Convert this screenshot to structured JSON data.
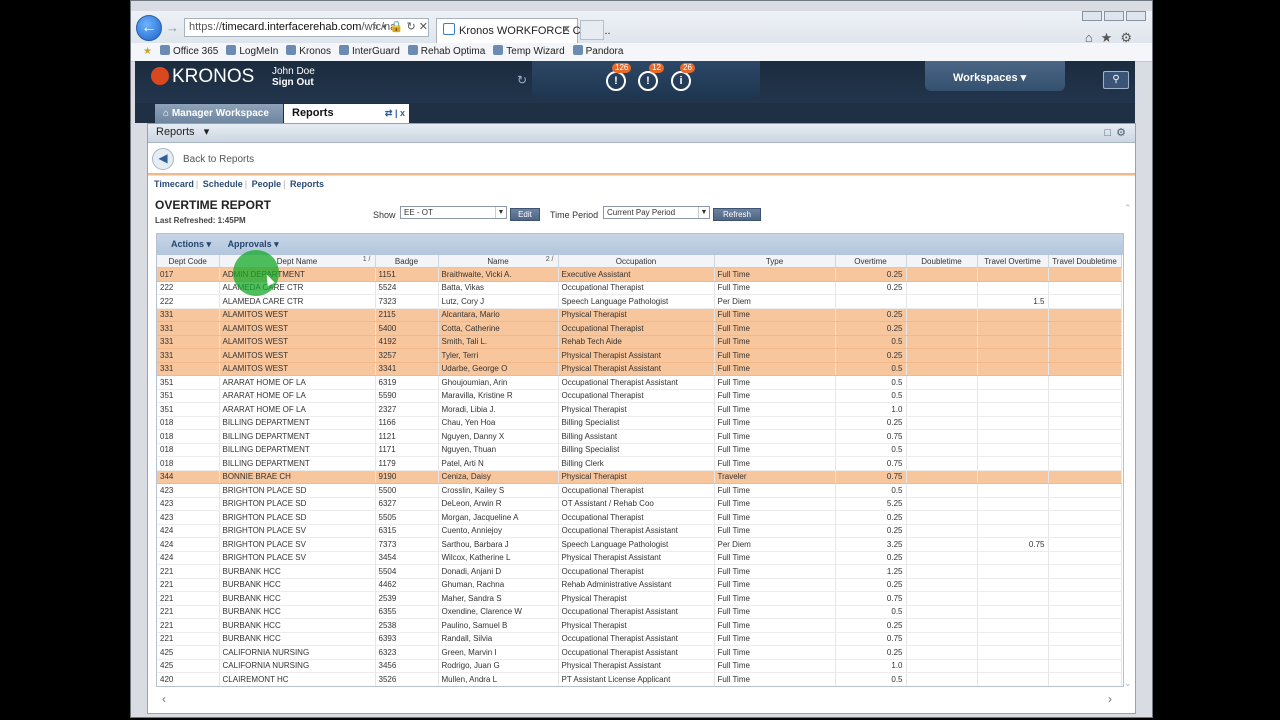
{
  "browser": {
    "url_prefix": "https://",
    "url_domain": "timecard.interfacerehab.com",
    "url_rest": "/wfc/na",
    "tab_title": "Kronos WORKFORCE CENT...",
    "favorites": [
      "Office 365",
      "LogMeIn",
      "Kronos",
      "InterGuard",
      "Rehab Optima",
      "Temp Wizard",
      "Pandora"
    ]
  },
  "header": {
    "logo": "KRONOS",
    "user_name": "John Doe",
    "sign_out": "Sign Out",
    "alerts": [
      {
        "icon": "info-alert-icon",
        "count": "126",
        "glyph": "!"
      },
      {
        "icon": "timecard-alert-icon",
        "count": "12",
        "glyph": "!"
      },
      {
        "icon": "people-alert-icon",
        "count": "26",
        "glyph": "i"
      }
    ],
    "workspaces_label": "Workspaces"
  },
  "tabs": {
    "manager": "Manager Workspace",
    "reports": "Reports"
  },
  "panel": {
    "title": "Reports",
    "back_label": "Back to Reports",
    "nav_links": [
      "Timecard",
      "Schedule",
      "People",
      "Reports"
    ]
  },
  "report": {
    "title": "OVERTIME REPORT",
    "last_refreshed": "Last Refreshed: 1:45PM",
    "show_label": "Show",
    "show_value": "EE - OT",
    "edit_label": "Edit",
    "time_period_label": "Time Period",
    "time_period_value": "Current Pay Period",
    "refresh_label": "Refresh",
    "actions_label": "Actions",
    "approvals_label": "Approvals"
  },
  "columns": [
    "Dept Code",
    "Dept Name",
    "Badge",
    "Name",
    "Occupation",
    "Type",
    "Overtime",
    "Doubletime",
    "Travel Overtime",
    "Travel Doubletime"
  ],
  "sort_marks": {
    "dept_name": "1 /",
    "name": "2 /"
  },
  "rows": [
    {
      "code": "017",
      "dept": "ADMIN DEPARTMENT",
      "badge": "1151",
      "name": "Braithwaite, Vicki A.",
      "occ": "Executive Assistant",
      "type": "Full Time",
      "ot": "0.25",
      "dt": "",
      "tot": "",
      "tdt": "",
      "hl": true
    },
    {
      "code": "222",
      "dept": "ALAMEDA CARE CTR",
      "badge": "5524",
      "name": "Batta, Vikas",
      "occ": "Occupational Therapist",
      "type": "Full Time",
      "ot": "0.25",
      "dt": "",
      "tot": "",
      "tdt": "",
      "hl": false
    },
    {
      "code": "222",
      "dept": "ALAMEDA CARE CTR",
      "badge": "7323",
      "name": "Lutz, Cory J",
      "occ": "Speech Language Pathologist",
      "type": "Per Diem",
      "ot": "",
      "dt": "",
      "tot": "1.5",
      "tdt": "",
      "hl": false
    },
    {
      "code": "331",
      "dept": "ALAMITOS WEST",
      "badge": "2115",
      "name": "Alcantara, Mario",
      "occ": "Physical Therapist",
      "type": "Full Time",
      "ot": "0.25",
      "dt": "",
      "tot": "",
      "tdt": "",
      "hl": true
    },
    {
      "code": "331",
      "dept": "ALAMITOS WEST",
      "badge": "5400",
      "name": "Cotta, Catherine",
      "occ": "Occupational Therapist",
      "type": "Full Time",
      "ot": "0.25",
      "dt": "",
      "tot": "",
      "tdt": "",
      "hl": true
    },
    {
      "code": "331",
      "dept": "ALAMITOS WEST",
      "badge": "4192",
      "name": "Smith, Tali L.",
      "occ": "Rehab Tech Aide",
      "type": "Full Time",
      "ot": "0.5",
      "dt": "",
      "tot": "",
      "tdt": "",
      "hl": true
    },
    {
      "code": "331",
      "dept": "ALAMITOS WEST",
      "badge": "3257",
      "name": "Tyler, Terri",
      "occ": "Physical Therapist Assistant",
      "type": "Full Time",
      "ot": "0.25",
      "dt": "",
      "tot": "",
      "tdt": "",
      "hl": true
    },
    {
      "code": "331",
      "dept": "ALAMITOS WEST",
      "badge": "3341",
      "name": "Udarbe, George O",
      "occ": "Physical Therapist Assistant",
      "type": "Full Time",
      "ot": "0.5",
      "dt": "",
      "tot": "",
      "tdt": "",
      "hl": true
    },
    {
      "code": "351",
      "dept": "ARARAT HOME OF LA",
      "badge": "6319",
      "name": "Ghoujoumian, Arin",
      "occ": "Occupational Therapist Assistant",
      "type": "Full Time",
      "ot": "0.5",
      "dt": "",
      "tot": "",
      "tdt": "",
      "hl": false
    },
    {
      "code": "351",
      "dept": "ARARAT HOME OF LA",
      "badge": "5590",
      "name": "Maravilla, Kristine R",
      "occ": "Occupational Therapist",
      "type": "Full Time",
      "ot": "0.5",
      "dt": "",
      "tot": "",
      "tdt": "",
      "hl": false
    },
    {
      "code": "351",
      "dept": "ARARAT HOME OF LA",
      "badge": "2327",
      "name": "Moradi, Libia J.",
      "occ": "Physical Therapist",
      "type": "Full Time",
      "ot": "1.0",
      "dt": "",
      "tot": "",
      "tdt": "",
      "hl": false
    },
    {
      "code": "018",
      "dept": "BILLING DEPARTMENT",
      "badge": "1166",
      "name": "Chau, Yen Hoa",
      "occ": "Billing Specialist",
      "type": "Full Time",
      "ot": "0.25",
      "dt": "",
      "tot": "",
      "tdt": "",
      "hl": false
    },
    {
      "code": "018",
      "dept": "BILLING DEPARTMENT",
      "badge": "1121",
      "name": "Nguyen, Danny X",
      "occ": "Billing Assistant",
      "type": "Full Time",
      "ot": "0.75",
      "dt": "",
      "tot": "",
      "tdt": "",
      "hl": false
    },
    {
      "code": "018",
      "dept": "BILLING DEPARTMENT",
      "badge": "1171",
      "name": "Nguyen, Thuan",
      "occ": "Billing Specialist",
      "type": "Full Time",
      "ot": "0.5",
      "dt": "",
      "tot": "",
      "tdt": "",
      "hl": false
    },
    {
      "code": "018",
      "dept": "BILLING DEPARTMENT",
      "badge": "1179",
      "name": "Patel, Arti N",
      "occ": "Billing Clerk",
      "type": "Full Time",
      "ot": "0.75",
      "dt": "",
      "tot": "",
      "tdt": "",
      "hl": false
    },
    {
      "code": "344",
      "dept": "BONNIE BRAE CH",
      "badge": "9190",
      "name": "Ceniza, Daisy",
      "occ": "Physical Therapist",
      "type": "Traveler",
      "ot": "0.75",
      "dt": "",
      "tot": "",
      "tdt": "",
      "hl": true
    },
    {
      "code": "423",
      "dept": "BRIGHTON PLACE SD",
      "badge": "5500",
      "name": "Crosslin, Kailey S",
      "occ": "Occupational Therapist",
      "type": "Full Time",
      "ot": "0.5",
      "dt": "",
      "tot": "",
      "tdt": "",
      "hl": false
    },
    {
      "code": "423",
      "dept": "BRIGHTON PLACE SD",
      "badge": "6327",
      "name": "DeLeon, Arwin R",
      "occ": "OT Assistant / Rehab Coo",
      "type": "Full Time",
      "ot": "5.25",
      "dt": "",
      "tot": "",
      "tdt": "",
      "hl": false
    },
    {
      "code": "423",
      "dept": "BRIGHTON PLACE SD",
      "badge": "5505",
      "name": "Morgan, Jacqueline A",
      "occ": "Occupational Therapist",
      "type": "Full Time",
      "ot": "0.25",
      "dt": "",
      "tot": "",
      "tdt": "",
      "hl": false
    },
    {
      "code": "424",
      "dept": "BRIGHTON PLACE SV",
      "badge": "6315",
      "name": "Cuento, Anniejoy",
      "occ": "Occupational Therapist Assistant",
      "type": "Full Time",
      "ot": "0.25",
      "dt": "",
      "tot": "",
      "tdt": "",
      "hl": false
    },
    {
      "code": "424",
      "dept": "BRIGHTON PLACE SV",
      "badge": "7373",
      "name": "Sarthou, Barbara J",
      "occ": "Speech Language Pathologist",
      "type": "Per Diem",
      "ot": "3.25",
      "dt": "",
      "tot": "0.75",
      "tdt": "",
      "hl": false
    },
    {
      "code": "424",
      "dept": "BRIGHTON PLACE SV",
      "badge": "3454",
      "name": "Wilcox, Katherine L",
      "occ": "Physical Therapist Assistant",
      "type": "Full Time",
      "ot": "0.25",
      "dt": "",
      "tot": "",
      "tdt": "",
      "hl": false
    },
    {
      "code": "221",
      "dept": "BURBANK HCC",
      "badge": "5504",
      "name": "Donadi, Anjani D",
      "occ": "Occupational Therapist",
      "type": "Full Time",
      "ot": "1.25",
      "dt": "",
      "tot": "",
      "tdt": "",
      "hl": false
    },
    {
      "code": "221",
      "dept": "BURBANK HCC",
      "badge": "4462",
      "name": "Ghuman, Rachna",
      "occ": "Rehab Administrative Assistant",
      "type": "Full Time",
      "ot": "0.25",
      "dt": "",
      "tot": "",
      "tdt": "",
      "hl": false
    },
    {
      "code": "221",
      "dept": "BURBANK HCC",
      "badge": "2539",
      "name": "Maher, Sandra S",
      "occ": "Physical Therapist",
      "type": "Full Time",
      "ot": "0.75",
      "dt": "",
      "tot": "",
      "tdt": "",
      "hl": false
    },
    {
      "code": "221",
      "dept": "BURBANK HCC",
      "badge": "6355",
      "name": "Oxendine, Clarence W",
      "occ": "Occupational Therapist Assistant",
      "type": "Full Time",
      "ot": "0.5",
      "dt": "",
      "tot": "",
      "tdt": "",
      "hl": false
    },
    {
      "code": "221",
      "dept": "BURBANK HCC",
      "badge": "2538",
      "name": "Paulino, Samuel B",
      "occ": "Physical Therapist",
      "type": "Full Time",
      "ot": "0.25",
      "dt": "",
      "tot": "",
      "tdt": "",
      "hl": false
    },
    {
      "code": "221",
      "dept": "BURBANK HCC",
      "badge": "6393",
      "name": "Randall, Silvia",
      "occ": "Occupational Therapist Assistant",
      "type": "Full Time",
      "ot": "0.75",
      "dt": "",
      "tot": "",
      "tdt": "",
      "hl": false
    },
    {
      "code": "425",
      "dept": "CALIFORNIA NURSING",
      "badge": "6323",
      "name": "Green, Marvin I",
      "occ": "Occupational Therapist Assistant",
      "type": "Full Time",
      "ot": "0.25",
      "dt": "",
      "tot": "",
      "tdt": "",
      "hl": false
    },
    {
      "code": "425",
      "dept": "CALIFORNIA NURSING",
      "badge": "3456",
      "name": "Rodrigo, Juan G",
      "occ": "Physical Therapist Assistant",
      "type": "Full Time",
      "ot": "1.0",
      "dt": "",
      "tot": "",
      "tdt": "",
      "hl": false
    },
    {
      "code": "420",
      "dept": "CLAIREMONT HC",
      "badge": "3526",
      "name": "Mullen, Andra L",
      "occ": "PT Assistant License Applicant",
      "type": "Full Time",
      "ot": "0.5",
      "dt": "",
      "tot": "",
      "tdt": "",
      "hl": false
    }
  ]
}
